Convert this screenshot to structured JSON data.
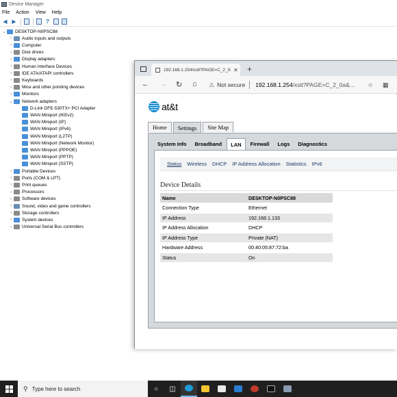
{
  "device_manager": {
    "title": "Device Manager",
    "menu": [
      "File",
      "Action",
      "View",
      "Help"
    ],
    "root": "DESKTOP-N0PSC88",
    "categories": [
      {
        "label": "Audio inputs and outputs",
        "icon": "speaker-icon",
        "color": "#6b8fb5"
      },
      {
        "label": "Computer",
        "icon": "monitor-icon",
        "color": "#4a90d9"
      },
      {
        "label": "Disk drives",
        "icon": "disk-icon",
        "color": "#8a8a8a"
      },
      {
        "label": "Display adapters",
        "icon": "display-adapter-icon",
        "color": "#4a90d9"
      },
      {
        "label": "Human Interface Devices",
        "icon": "hid-icon",
        "color": "#8a8a8a"
      },
      {
        "label": "IDE ATA/ATAPI controllers",
        "icon": "controller-icon",
        "color": "#8a8a8a"
      },
      {
        "label": "Keyboards",
        "icon": "keyboard-icon",
        "color": "#8a8a8a"
      },
      {
        "label": "Mice and other pointing devices",
        "icon": "mouse-icon",
        "color": "#8a8a8a"
      },
      {
        "label": "Monitors",
        "icon": "monitor-icon",
        "color": "#4a90d9"
      },
      {
        "label": "Network adapters",
        "icon": "network-adapter-icon",
        "color": "#4a90d9"
      }
    ],
    "network_children": [
      "D-Link DFE-530TX+ PCI Adapter",
      "WAN Miniport (IKEv2)",
      "WAN Miniport (IP)",
      "WAN Miniport (IPv6)",
      "WAN Miniport (L2TP)",
      "WAN Miniport (Network Monitor)",
      "WAN Miniport (PPPOE)",
      "WAN Miniport (PPTP)",
      "WAN Miniport (SSTP)"
    ],
    "more_categories": [
      {
        "label": "Portable Devices",
        "icon": "portable-device-icon",
        "color": "#4a90d9"
      },
      {
        "label": "Ports (COM & LPT)",
        "icon": "port-icon",
        "color": "#8a8a8a"
      },
      {
        "label": "Print queues",
        "icon": "printer-icon",
        "color": "#8a8a8a"
      },
      {
        "label": "Processors",
        "icon": "processor-icon",
        "color": "#8a8a8a"
      },
      {
        "label": "Software devices",
        "icon": "software-device-icon",
        "color": "#8a8a8a"
      },
      {
        "label": "Sound, video and game controllers",
        "icon": "sound-icon",
        "color": "#6b8fb5"
      },
      {
        "label": "Storage controllers",
        "icon": "storage-icon",
        "color": "#8a8a8a"
      },
      {
        "label": "System devices",
        "icon": "system-device-icon",
        "color": "#4a90d9"
      },
      {
        "label": "Universal Serial Bus controllers",
        "icon": "usb-icon",
        "color": "#8a8a8a"
      }
    ]
  },
  "browser": {
    "tab_title": "192.168.1.254/xslt?PAGE=C_2_0a",
    "security": "Not secure",
    "url_host": "192.168.1.254",
    "url_path": "/xslt?PAGE=C_2_0a&..."
  },
  "router": {
    "brand": "at&t",
    "top_tabs": [
      "Home",
      "Settings",
      "Site Map"
    ],
    "sub_tabs": [
      "System Info",
      "Broadband",
      "LAN",
      "Firewall",
      "Logs",
      "Diagnostics"
    ],
    "lan_tabs": [
      "Status",
      "Wireless",
      "DHCP",
      "IP Address Allocation",
      "Statistics",
      "IPv6"
    ],
    "section_title": "Device Details",
    "details": [
      {
        "key": "Name",
        "value": "DESKTOP-N0PSC88"
      },
      {
        "key": "Connection Type",
        "value": "Ethernet"
      },
      {
        "key": "IP Address",
        "value": "192.168.1.133"
      },
      {
        "key": "IP Address Allocation",
        "value": "DHCP"
      },
      {
        "key": "IP Address Type",
        "value": "Private (NAT)"
      },
      {
        "key": "Hardware Address",
        "value": "00:40:05:87:72:ba"
      },
      {
        "key": "Status",
        "value": "On"
      }
    ]
  },
  "taskbar": {
    "search_placeholder": "Type here to search"
  }
}
